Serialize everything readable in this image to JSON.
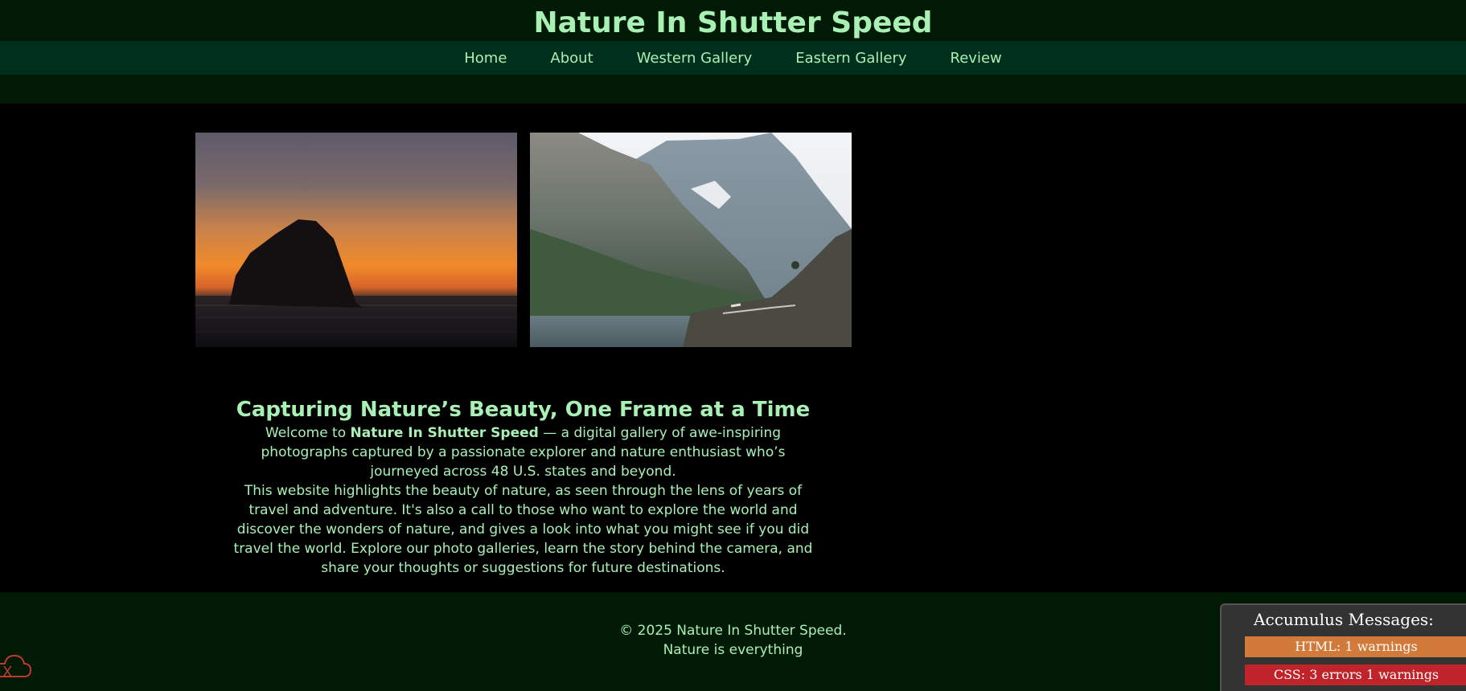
{
  "header": {
    "title": "Nature In Shutter Speed"
  },
  "nav": {
    "items": [
      {
        "label": "Home"
      },
      {
        "label": "About"
      },
      {
        "label": "Western Gallery"
      },
      {
        "label": "Eastern Gallery"
      },
      {
        "label": "Review"
      }
    ]
  },
  "gallery": {
    "photos": [
      {
        "subject": "sea stack silhouette at sunset"
      },
      {
        "subject": "mountain valley with lake and road"
      }
    ]
  },
  "intro": {
    "heading": "Capturing Nature’s Beauty, One Frame at a Time",
    "welcome_prefix": "Welcome to ",
    "welcome_strong": "Nature In Shutter Speed",
    "welcome_suffix": " — a digital gallery of awe-inspiring photographs captured by a passionate explorer and nature enthusiast who’s journeyed across 48 U.S. states and beyond.",
    "body": "This website highlights the beauty of nature, as seen through the lens of years of travel and adventure. It's also a call to those who want to explore the world and discover the wonders of nature, and gives a look into what you might see if you did travel the world. Explore our photo galleries, learn the story behind the camera, and share your thoughts or suggestions for future destinations."
  },
  "footer": {
    "copyright": "© 2025 Nature In Shutter Speed.",
    "tagline": "Nature is everything"
  },
  "accumulus": {
    "title": "Accumulus Messages:",
    "html_status": "HTML: 1 warnings",
    "css_status": "CSS: 3 errors 1 warnings"
  },
  "colors": {
    "header_bg": "#001a05",
    "nav_bg": "#00301d",
    "text_green": "#a8f0b4",
    "warning_orange": "#d27a3a",
    "error_red": "#c0232a"
  }
}
